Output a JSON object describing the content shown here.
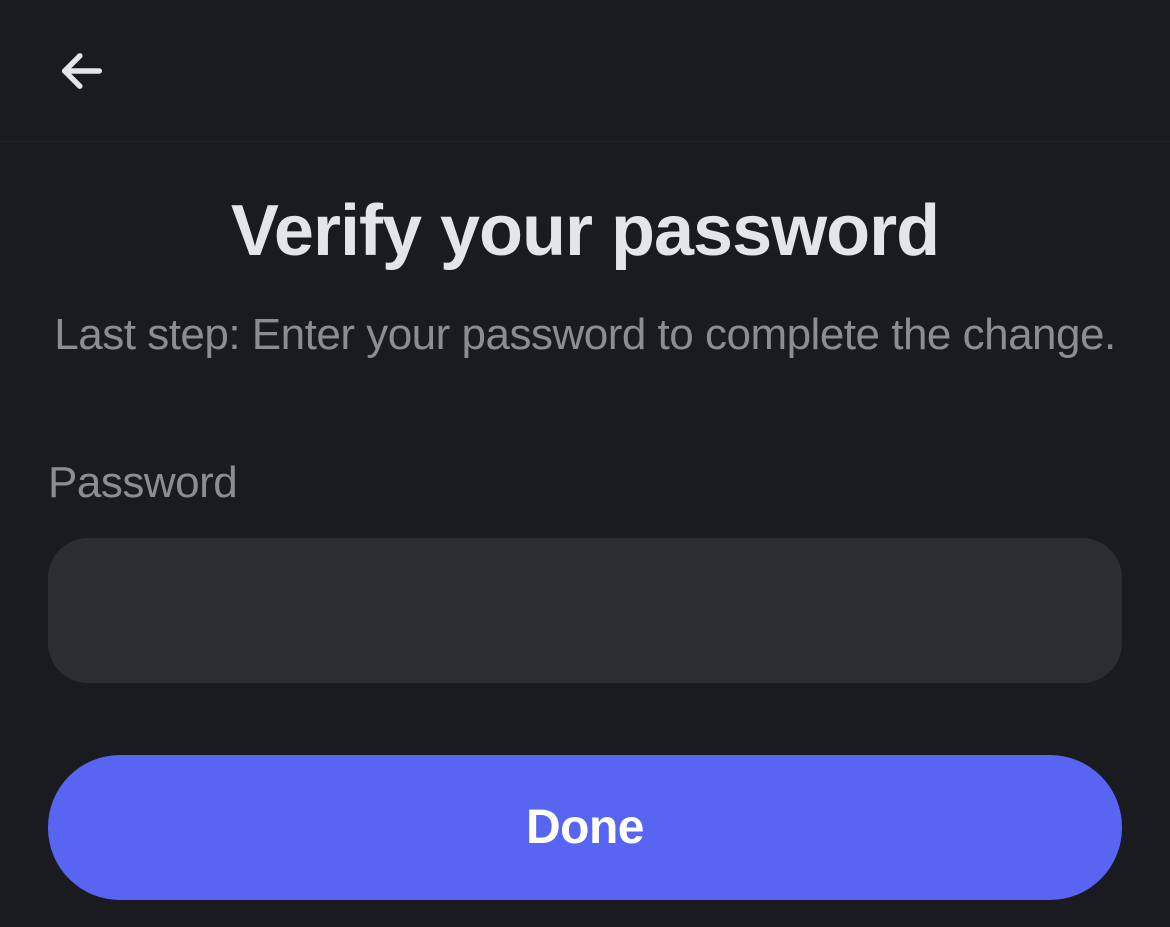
{
  "header": {
    "back_icon": "arrow-left"
  },
  "main": {
    "title": "Verify your password",
    "subtitle": "Last step: Enter your password to complete the change.",
    "password_label": "Password",
    "password_value": "",
    "done_label": "Done"
  },
  "colors": {
    "background": "#1a1b1e",
    "input_background": "#2c2d33",
    "button_primary": "#5865f2",
    "text_primary": "#e4e5e8",
    "text_secondary": "#8b8d93"
  }
}
